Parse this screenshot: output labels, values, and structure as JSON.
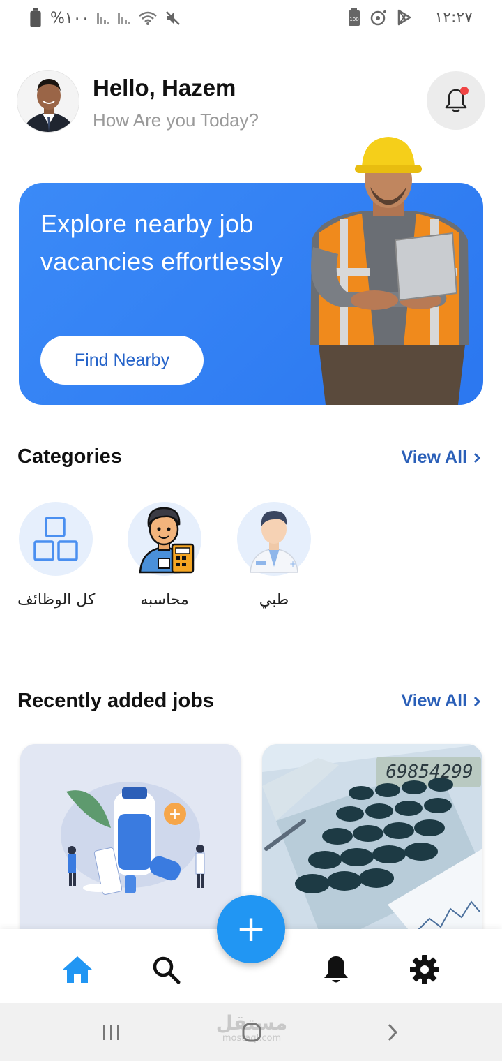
{
  "status_bar": {
    "battery_percent": "%١٠٠",
    "time": "١٢:٢٧",
    "left_icons": [
      "battery-icon",
      "signal-icon",
      "signal-icon",
      "wifi-icon",
      "mute-icon"
    ],
    "right_icons": [
      "battery-saver-icon",
      "record-icon",
      "play-store-icon"
    ]
  },
  "header": {
    "greeting": "Hello, Hazem",
    "subtitle": "How Are you Today?",
    "notification_icon": "bell-icon",
    "has_unread": true
  },
  "banner": {
    "headline": "Explore nearby job vacancies effortlessly",
    "button_label": "Find Nearby",
    "background_color": "#2f7ff3"
  },
  "categories": {
    "title": "Categories",
    "view_all": "View All",
    "items": [
      {
        "label": "كل الوظائف",
        "icon": "grid-icon"
      },
      {
        "label": "محاسبه",
        "icon": "accountant-icon"
      },
      {
        "label": "طبي",
        "icon": "doctor-icon"
      }
    ]
  },
  "recent_jobs": {
    "title": "Recently added jobs",
    "view_all": "View All",
    "cards": [
      {
        "image": "pharmacy-illustration"
      },
      {
        "image": "calculator-photo",
        "display_number": "69854299"
      }
    ]
  },
  "bottom_nav": {
    "items": [
      "home-icon",
      "search-icon",
      "notifications-icon",
      "settings-icon"
    ],
    "active": "home-icon",
    "fab_label": "+",
    "accent_color": "#2196f3"
  },
  "system_nav": {
    "watermark_ar": "مستقل",
    "watermark_en": "mostaql.com"
  }
}
